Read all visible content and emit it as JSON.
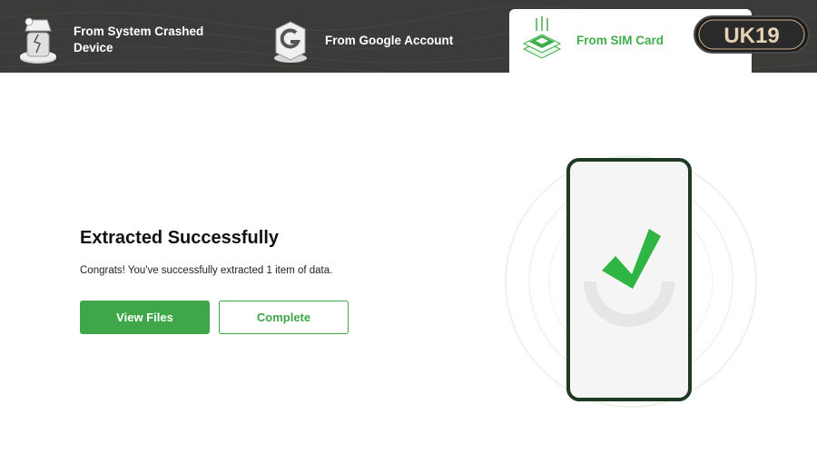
{
  "tabs": [
    {
      "label": "From System Crashed Device",
      "icon": "crashed-device-icon",
      "active": false
    },
    {
      "label": "From Google Account",
      "icon": "google-account-icon",
      "active": false
    },
    {
      "label": "From SIM Card",
      "icon": "sim-card-icon",
      "active": true
    }
  ],
  "logo": {
    "text": "UK19"
  },
  "result": {
    "title": "Extracted Successfully",
    "message": "Congrats! You've successfully extracted 1 item of data."
  },
  "buttons": {
    "view_files": "View Files",
    "complete": "Complete"
  },
  "colors": {
    "accent": "#3fa64a",
    "header_bg": "#3b3b39",
    "phone_frame": "#1e3a24",
    "phone_screen": "#f5f5f5"
  }
}
